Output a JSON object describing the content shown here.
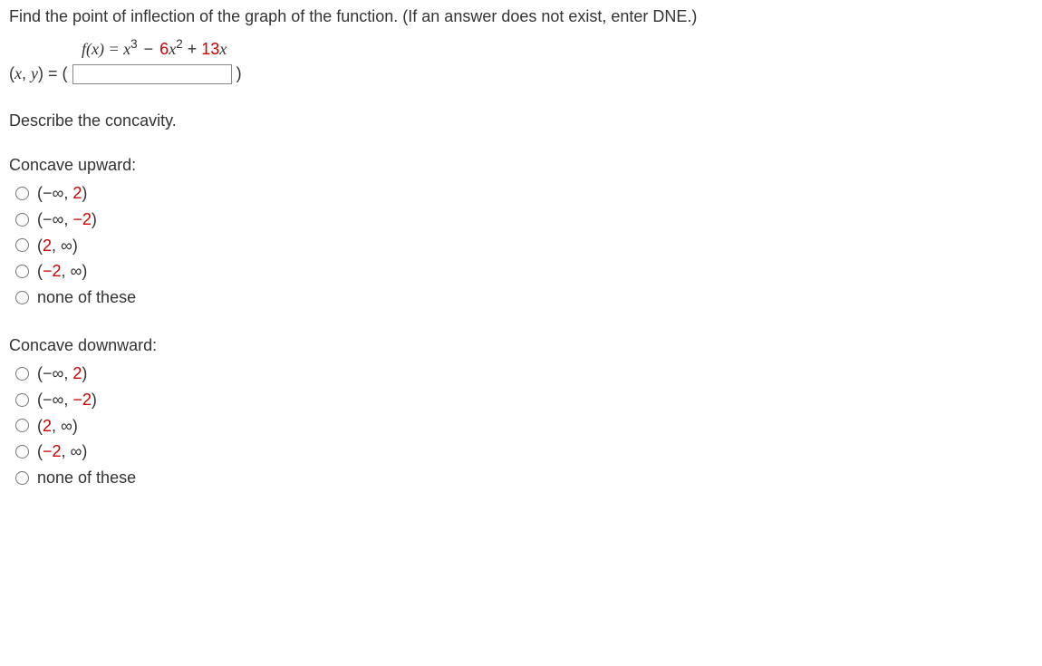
{
  "question": {
    "prompt": "Find the point of inflection of the graph of the function. (If an answer does not exist, enter DNE.)",
    "func_lhs_f": "f",
    "func_lhs_x": "(x) = ",
    "func_rhs_x3": "x",
    "func_rhs_pow3": "3",
    "func_rhs_minus": " − ",
    "func_rhs_6": "6",
    "func_rhs_x2": "x",
    "func_rhs_pow2": "2",
    "func_rhs_plus": " + ",
    "func_rhs_13": "13",
    "func_rhs_xend": "x",
    "answer_label_open": "(",
    "answer_label_x": "x",
    "answer_label_comma": ", ",
    "answer_label_y": "y",
    "answer_label_close": ") = (",
    "answer_after": ")"
  },
  "concavity": {
    "heading": "Describe the concavity.",
    "upward_heading": "Concave upward:",
    "downward_heading": "Concave downward:",
    "options_upward": [
      {
        "open": "(",
        "a": "−∞",
        "comma": ", ",
        "b": "2",
        "close": ")",
        "a_red": false,
        "b_red": true
      },
      {
        "open": "(",
        "a": "−∞",
        "comma": ", ",
        "b": "−2",
        "close": ")",
        "a_red": false,
        "b_red": true
      },
      {
        "open": "(",
        "a": "2",
        "comma": ", ",
        "b": "∞",
        "close": ")",
        "a_red": true,
        "b_red": false
      },
      {
        "open": "(",
        "a": "−2",
        "comma": ", ",
        "b": "∞",
        "close": ")",
        "a_red": true,
        "b_red": false
      },
      {
        "text": "none of these"
      }
    ],
    "options_downward": [
      {
        "open": "(",
        "a": "−∞",
        "comma": ", ",
        "b": "2",
        "close": ")",
        "a_red": false,
        "b_red": true
      },
      {
        "open": "(",
        "a": "−∞",
        "comma": ", ",
        "b": "−2",
        "close": ")",
        "a_red": false,
        "b_red": true
      },
      {
        "open": "(",
        "a": "2",
        "comma": ", ",
        "b": "∞",
        "close": ")",
        "a_red": true,
        "b_red": false
      },
      {
        "open": "(",
        "a": "−2",
        "comma": ", ",
        "b": "∞",
        "close": ")",
        "a_red": true,
        "b_red": false
      },
      {
        "text": "none of these"
      }
    ]
  }
}
